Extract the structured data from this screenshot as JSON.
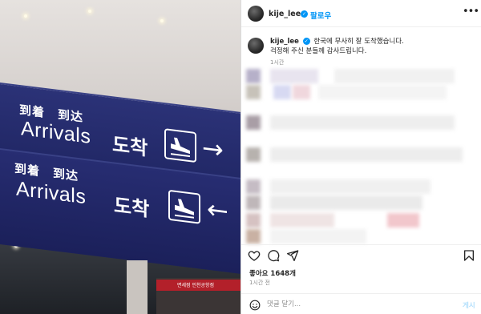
{
  "photo": {
    "sign_top": {
      "cjk": "到着　到达",
      "en": "Arrivals",
      "ko": "도착",
      "arrow": "→"
    },
    "sign_bottom": {
      "cjk": "到着　到达",
      "en": "Arrivals",
      "ko": "도착",
      "arrow": "←"
    },
    "store_sign": "면세점 인천공항점"
  },
  "header": {
    "username": "kije_lee",
    "verified_icon": "verified-badge-icon",
    "follow_label": "팔로우",
    "more_icon": "more-options-icon"
  },
  "caption": {
    "username": "kije_lee",
    "line1": "한국에 무사히 잘 도착했습니다.",
    "line2": "걱정해 주신 분들께 감사드립니다.",
    "time": "1시간"
  },
  "actions": {
    "like_icon": "heart-icon",
    "comment_icon": "comment-icon",
    "share_icon": "share-icon",
    "save_icon": "bookmark-icon"
  },
  "likes_text": "좋아요 1648개",
  "post_time": "1시간 전",
  "comment": {
    "emoji_icon": "emoji-icon",
    "placeholder": "댓글 달기...",
    "post_label": "게시"
  },
  "colors": {
    "accent": "#0095f6",
    "sign_blue": "#232a6d"
  }
}
